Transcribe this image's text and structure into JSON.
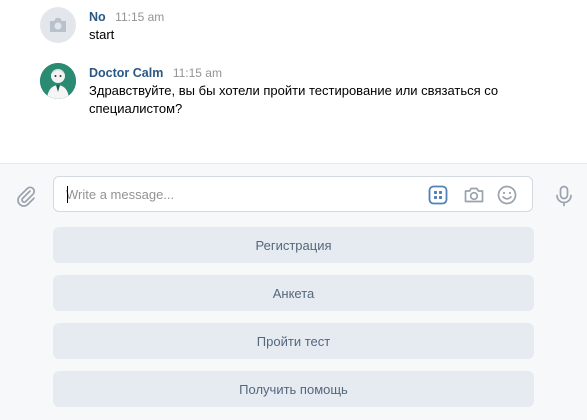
{
  "messages": [
    {
      "author": "No",
      "time": "11:15 am",
      "text": "start",
      "avatar": "camera-placeholder-icon"
    },
    {
      "author": "Doctor Calm",
      "time": "11:15 am",
      "text": "Здравствуйте, вы бы хотели пройти тестирование или связаться со специалистом?",
      "avatar": "doctor-portrait"
    }
  ],
  "composer": {
    "placeholder": "Write a message...",
    "value": "",
    "icons": [
      "paperclip-icon",
      "keyboard-icon",
      "camera-icon",
      "smiley-icon",
      "microphone-icon"
    ]
  },
  "keyboard": {
    "buttons": [
      {
        "label": "Регистрация"
      },
      {
        "label": "Анкета"
      },
      {
        "label": "Пройти тест"
      },
      {
        "label": "Получить помощь"
      }
    ]
  },
  "colors": {
    "author": "#2a5885",
    "time": "#939393",
    "button_bg": "#e5ebf1",
    "button_text": "#55677d",
    "composer_bg": "#f7f8fa",
    "keyboard_icon": "#5181b8"
  }
}
